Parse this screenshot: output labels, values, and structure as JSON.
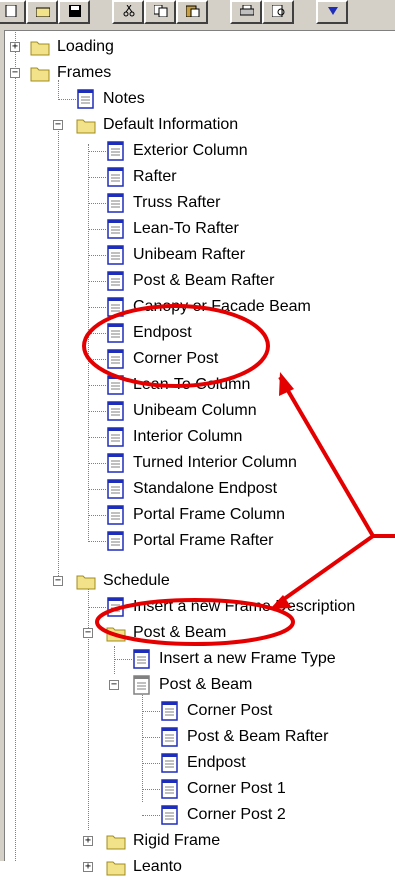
{
  "tree": {
    "loading": "Loading",
    "frames": "Frames",
    "notes": "Notes",
    "default_information": "Default Information",
    "default_items": [
      "Exterior Column",
      "Rafter",
      "Truss Rafter",
      "Lean-To Rafter",
      "Unibeam Rafter",
      "Post & Beam Rafter",
      "Canopy or Facade Beam",
      "Endpost",
      "Corner Post",
      "Lean-To Column",
      "Unibeam Column",
      "Interior Column",
      "Turned Interior Column",
      "Standalone Endpost",
      "Portal Frame Column",
      "Portal Frame Rafter"
    ],
    "schedule": "Schedule",
    "insert_frame_description": "Insert a new Frame Description",
    "post_beam_folder": "Post & Beam",
    "insert_frame_type": "Insert a new Frame Type",
    "post_beam_doc": "Post & Beam",
    "post_beam_items": [
      "Corner Post",
      "Post & Beam Rafter",
      "Endpost",
      "Corner Post 1",
      "Corner Post 2"
    ],
    "rigid_frame": "Rigid Frame",
    "leanto": "Leanto"
  },
  "colors": {
    "folder": "#f2e28a",
    "folder_dark": "#a08c1c",
    "doc_blue": "#1f2eb8",
    "annotation": "#e40000"
  }
}
